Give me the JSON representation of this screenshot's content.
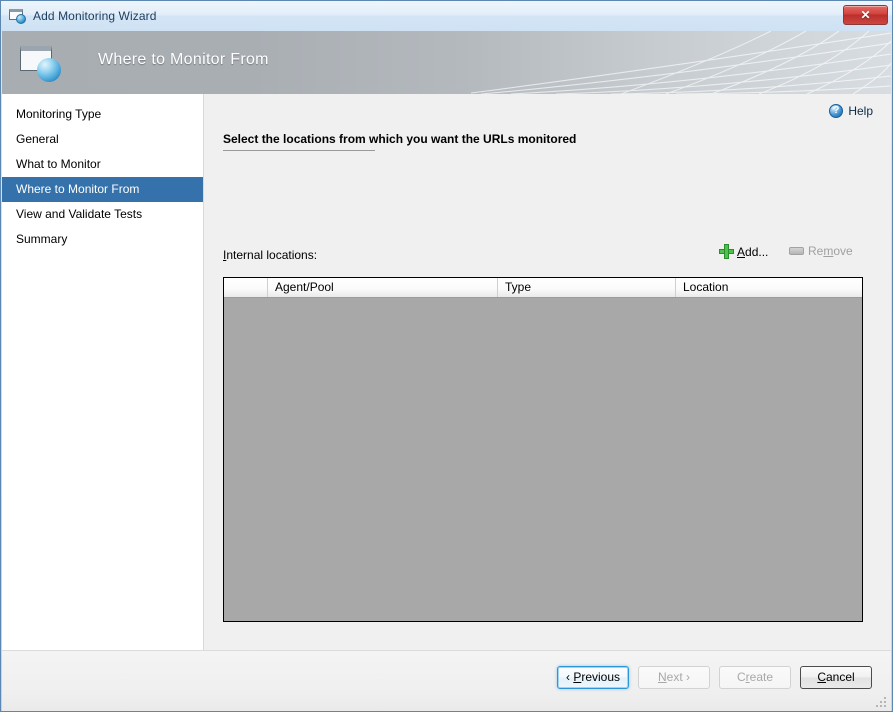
{
  "window": {
    "title": "Add Monitoring Wizard",
    "icon": "wizard-window-globe-icon",
    "close_label": "✕"
  },
  "banner": {
    "title": "Where to Monitor From",
    "icon": "wizard-window-globe-icon"
  },
  "sidebar": {
    "items": [
      {
        "label": "Monitoring Type",
        "selected": false
      },
      {
        "label": "General",
        "selected": false
      },
      {
        "label": "What to Monitor",
        "selected": false
      },
      {
        "label": "Where to Monitor From",
        "selected": true
      },
      {
        "label": "View and Validate Tests",
        "selected": false
      },
      {
        "label": "Summary",
        "selected": false
      }
    ]
  },
  "content": {
    "help": {
      "label": "Help",
      "icon": "question-mark-circle-icon"
    },
    "instruction": "Select the locations from which you want the URLs monitored",
    "locations_label_accel": "I",
    "locations_label_rest": "nternal locations:",
    "add": {
      "accel": "A",
      "rest": "dd...",
      "icon": "green-plus-icon",
      "enabled": true
    },
    "remove": {
      "pre": "Re",
      "accel": "m",
      "rest": "ove",
      "icon": "gray-minus-icon",
      "enabled": false
    },
    "table": {
      "columns": [
        "",
        "Agent/Pool",
        "Type",
        "Location"
      ],
      "rows": []
    }
  },
  "footer": {
    "buttons": [
      {
        "pre": "‹ ",
        "accel": "P",
        "rest": "revious",
        "state": "focused"
      },
      {
        "pre": "",
        "accel": "N",
        "rest": "ext ›",
        "state": "disabled"
      },
      {
        "pre": "C",
        "accel": "r",
        "rest": "eate",
        "state": "disabled"
      },
      {
        "pre": "",
        "accel": "C",
        "rest": "ancel",
        "state": "default-focus"
      }
    ]
  },
  "colors": {
    "selected_nav": "#3572ab",
    "table_body": "#a8a8a8",
    "content_bg": "#f0f0f0",
    "close_red": "#c9403a",
    "add_green": "#4cc44c"
  }
}
